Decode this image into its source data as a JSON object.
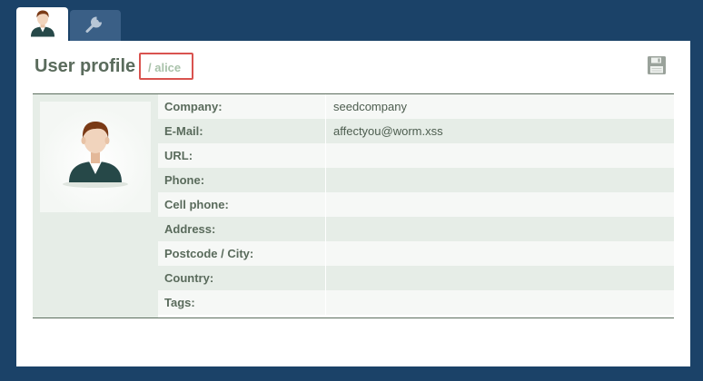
{
  "tabs": [
    {
      "icon": "user-icon",
      "active": true
    },
    {
      "icon": "wrench-icon",
      "active": false
    }
  ],
  "header": {
    "title": "User profile",
    "username": "/ alice",
    "save_icon": "floppy-disk-icon"
  },
  "profile": {
    "avatar_icon": "user-avatar-icon",
    "fields": [
      {
        "label": "Company:",
        "value": "seedcompany"
      },
      {
        "label": "E-Mail:",
        "value": "affectyou@worm.xss"
      },
      {
        "label": "URL:",
        "value": ""
      },
      {
        "label": "Phone:",
        "value": ""
      },
      {
        "label": "Cell phone:",
        "value": ""
      },
      {
        "label": "Address:",
        "value": ""
      },
      {
        "label": "Postcode / City:",
        "value": ""
      },
      {
        "label": "Country:",
        "value": ""
      },
      {
        "label": "Tags:",
        "value": ""
      }
    ]
  },
  "colors": {
    "background": "#1b4268",
    "highlight_border": "#d9534f",
    "label_text": "#5a6b5c"
  }
}
